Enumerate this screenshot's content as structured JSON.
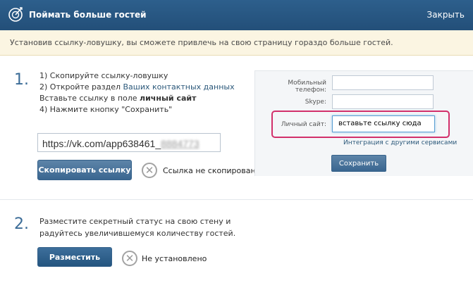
{
  "header": {
    "title": "Поймать больше гостей",
    "close_label": "Закрыть"
  },
  "notice": "Установив ссылку-ловушку, вы сможете привлечь на свою страницу гораздо больше гостей.",
  "step1": {
    "number": "1.",
    "line1": "1) Скопируйте ссылку-ловушку",
    "line2_prefix": "2) Откройте раздел ",
    "line2_link": "Ваших контактных данных",
    "line3_prefix": "Вставьте ссылку в поле ",
    "line3_bold": "личный сайт",
    "line4": "4) Нажмите кнопку \"Сохранить\"",
    "url_visible": "https://vk.com/app638461_",
    "url_blurred": "8884773",
    "copy_button": "Скопировать ссылку",
    "status": "Ссылка не скопирована"
  },
  "preview": {
    "mobile_label": "Мобильный телефон:",
    "skype_label": "Skype:",
    "site_label": "Личный сайт:",
    "site_value": "вставьте ссылку сюда",
    "integration_link": "Интеграция с другими сервисами",
    "save_button": "Сохранить"
  },
  "step2": {
    "number": "2.",
    "line1": "Разместите секретный статус на свою стену и",
    "line2": "радуйтесь увеличившемуся количеству гостей.",
    "place_button": "Разместить",
    "status": "Не установлено"
  },
  "icons": {
    "logo": "target-logo-icon",
    "status1": "close-circle-icon",
    "status2": "close-circle-icon"
  }
}
